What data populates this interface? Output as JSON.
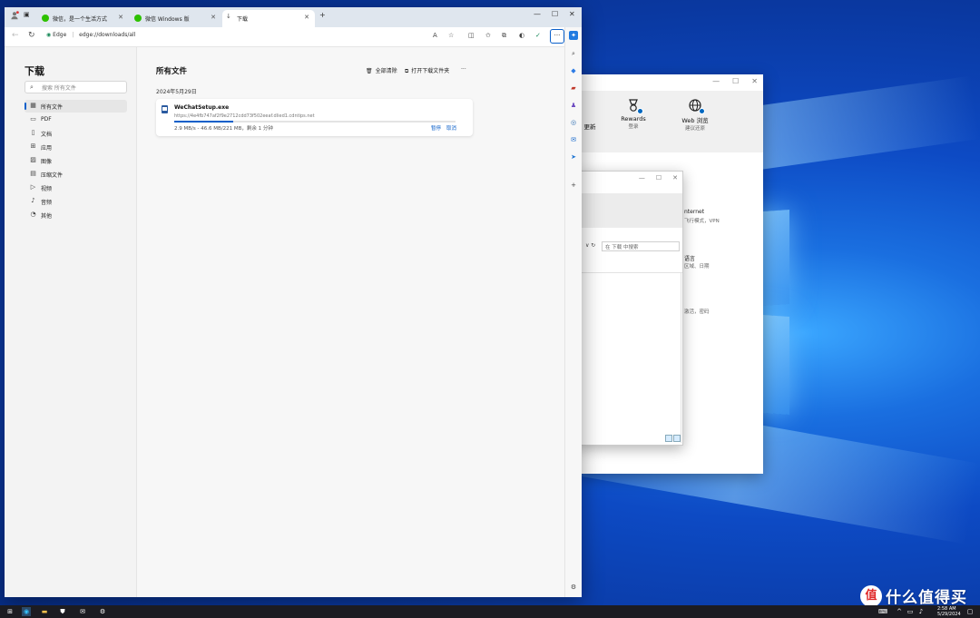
{
  "edge": {
    "tabs": [
      {
        "label": "微信，是一个生活方式",
        "favicon_color": "#2dc100"
      },
      {
        "label": "微信 Windows 版",
        "favicon_color": "#2dc100"
      },
      {
        "label": "下载",
        "favicon_color": "#555555"
      }
    ],
    "new_tab_glyph": "+",
    "window_controls": {
      "minimize": "—",
      "maximize": "☐",
      "close": "✕"
    },
    "toolbar": {
      "back": "←",
      "refresh": "↻",
      "site_label": "Edge",
      "separator": "|",
      "url": "edge://downloads/all",
      "ellipsis": "···"
    },
    "nav": {
      "title": "下载",
      "search_placeholder": "搜索 所有文件",
      "items": [
        {
          "label": "所有文件",
          "icon": "grid-icon",
          "glyph": "▦"
        },
        {
          "label": "PDF",
          "icon": "pdf-icon",
          "glyph": "▭"
        },
        {
          "label": "文档",
          "icon": "document-icon",
          "glyph": "▯"
        },
        {
          "label": "应用",
          "icon": "app-icon",
          "glyph": "⊞"
        },
        {
          "label": "图像",
          "icon": "image-icon",
          "glyph": "▨"
        },
        {
          "label": "压缩文件",
          "icon": "zip-icon",
          "glyph": "▤"
        },
        {
          "label": "视频",
          "icon": "video-icon",
          "glyph": "▷"
        },
        {
          "label": "音频",
          "icon": "audio-icon",
          "glyph": "♪"
        },
        {
          "label": "其他",
          "icon": "other-icon",
          "glyph": "◔"
        }
      ]
    },
    "main": {
      "title": "所有文件",
      "clear_all": "全部清除",
      "open_folder": "打开下载文件夹",
      "more": "···",
      "date": "2024年5月29日",
      "download": {
        "filename": "WeChatSetup.exe",
        "url": "https://4e4fb747af2f9e2712cdd73f502eeaf.dlied1.cdntips.net",
        "status": "2.9 MB/s - 46.6 MB/221 MB，剩余 1 分钟",
        "progress": 0.21,
        "pause_label": "暂停",
        "cancel_label": "取消"
      }
    },
    "sidebar_add": "+"
  },
  "settings": {
    "items": [
      {
        "title": "更新",
        "desc": ""
      },
      {
        "title": "Rewards",
        "desc": "登录"
      },
      {
        "title": "Web 浏览",
        "desc": "建议还原"
      }
    ],
    "partial_texts": [
      "nternet",
      "飞行模式，VPN",
      "语言",
      "区域、日期",
      "激活，密码"
    ]
  },
  "explorer": {
    "search_placeholder": "在 下载 中搜索",
    "nav_glyphs": "∨ ↻"
  },
  "taskbar": {
    "time": "2:58 AM",
    "date": "5/29/2024"
  },
  "watermark": {
    "badge": "值",
    "text": "什么值得买"
  }
}
